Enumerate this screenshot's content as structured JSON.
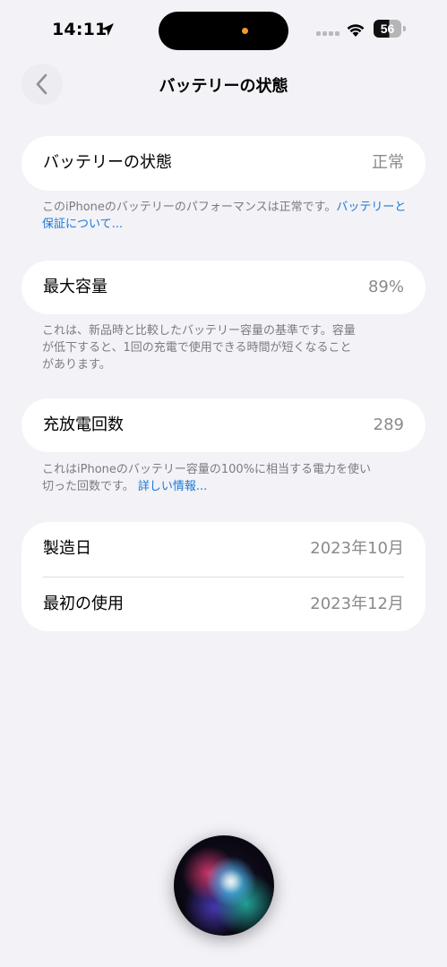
{
  "status_bar": {
    "time": "14:11",
    "battery_level": "56",
    "icons": [
      "location-arrow-icon",
      "cellular-signal-icon",
      "wifi-icon",
      "battery-icon"
    ],
    "island_indicator_color": "#f39a2b"
  },
  "nav": {
    "title": "バッテリーの状態",
    "back_icon": "chevron-left-icon"
  },
  "battery_state": {
    "label": "バッテリーの状態",
    "value": "正常",
    "footnote_text": "このiPhoneのバッテリーのパフォーマンスは正常です。",
    "footnote_link": "バッテリーと保証について..."
  },
  "max_capacity": {
    "label": "最大容量",
    "value": "89%",
    "footnote_line1": "これは、新品時と比較したバッテリー容量の基準です。容量",
    "footnote_line2": "が低下すると、1回の充電で使用できる時間が短くなること",
    "footnote_line3": "があります。"
  },
  "cycle_count": {
    "label": "充放電回数",
    "value": "289",
    "footnote_line1": "これはiPhoneのバッテリー容量の100%に相当する電力を使い",
    "footnote_line2": "切った回数です。",
    "footnote_link": "詳しい情報..."
  },
  "dates": {
    "manufacture_label": "製造日",
    "manufacture_value": "2023年10月",
    "first_use_label": "最初の使用",
    "first_use_value": "2023年12月"
  },
  "colors": {
    "background": "#f2f2f7",
    "card": "#ffffff",
    "secondary_text": "#8a8a8e",
    "link": "#1a78d6"
  }
}
